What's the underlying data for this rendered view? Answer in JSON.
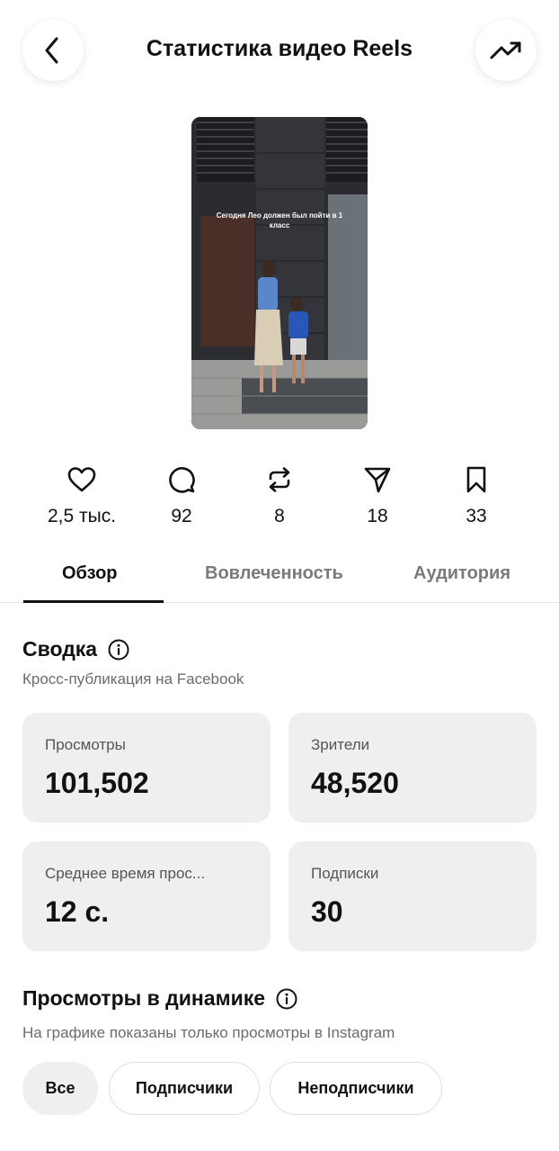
{
  "header": {
    "title": "Статистика видео Reels",
    "back_icon": "chevron-left-icon",
    "right_icon": "trending-up-icon"
  },
  "video": {
    "caption": "Сегодня Лео должен был пойти в 1 класс"
  },
  "stats": [
    {
      "icon": "heart-icon",
      "value": "2,5 тыс."
    },
    {
      "icon": "comment-icon",
      "value": "92"
    },
    {
      "icon": "repost-icon",
      "value": "8"
    },
    {
      "icon": "send-icon",
      "value": "18"
    },
    {
      "icon": "bookmark-icon",
      "value": "33"
    }
  ],
  "tabs": [
    {
      "label": "Обзор",
      "active": true
    },
    {
      "label": "Вовлеченность",
      "active": false
    },
    {
      "label": "Аудитория",
      "active": false
    }
  ],
  "summary": {
    "title": "Сводка",
    "subtitle": "Кросс-публикация на Facebook",
    "cards": [
      {
        "label": "Просмотры",
        "value": "101,502"
      },
      {
        "label": "Зрители",
        "value": "48,520"
      },
      {
        "label": "Среднее время прос...",
        "value": "12 с."
      },
      {
        "label": "Подписки",
        "value": "30"
      }
    ]
  },
  "views_dynamics": {
    "title": "Просмотры в динамике",
    "subtitle": "На графике показаны только просмотры в Instagram",
    "filters": [
      {
        "label": "Все",
        "active": true
      },
      {
        "label": "Подписчики",
        "active": false
      },
      {
        "label": "Неподписчики",
        "active": false
      }
    ]
  }
}
